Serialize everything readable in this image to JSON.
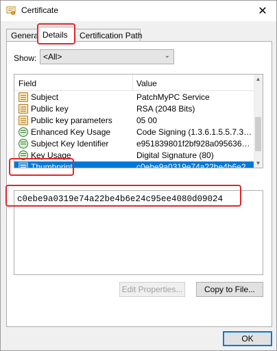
{
  "window": {
    "title": "Certificate",
    "close_glyph": "✕"
  },
  "tabs": [
    {
      "label": "General",
      "active": false
    },
    {
      "label": "Details",
      "active": true
    },
    {
      "label": "Certification Path",
      "active": false
    }
  ],
  "show": {
    "label": "Show:",
    "selected": "<All>"
  },
  "list": {
    "columns": {
      "field": "Field",
      "value": "Value"
    },
    "rows": [
      {
        "field": "Subject",
        "value": "PatchMyPC Service",
        "icon": "cert-field-icon"
      },
      {
        "field": "Public key",
        "value": "RSA (2048 Bits)",
        "icon": "cert-field-icon"
      },
      {
        "field": "Public key parameters",
        "value": "05 00",
        "icon": "cert-field-icon"
      },
      {
        "field": "Enhanced Key Usage",
        "value": "Code Signing (1.3.6.1.5.5.7.3.3)",
        "icon": "extension-icon"
      },
      {
        "field": "Subject Key Identifier",
        "value": "e951839801f2bf928a095636e...",
        "icon": "extension-icon"
      },
      {
        "field": "Key Usage",
        "value": "Digital Signature (80)",
        "icon": "extension-icon"
      },
      {
        "field": "Thumbprint",
        "value": "c0ebe9a0319e74a22be4b6e2...",
        "icon": "cert-field-icon",
        "selected": true
      }
    ]
  },
  "detail_value": "c0ebe9a0319e74a22be4b6e24c95ee4080d09024",
  "buttons": {
    "edit_properties": "Edit Properties...",
    "copy_to_file": "Copy to File...",
    "ok": "OK"
  },
  "colors": {
    "selection": "#0078d7",
    "highlight": "#e0252b"
  }
}
